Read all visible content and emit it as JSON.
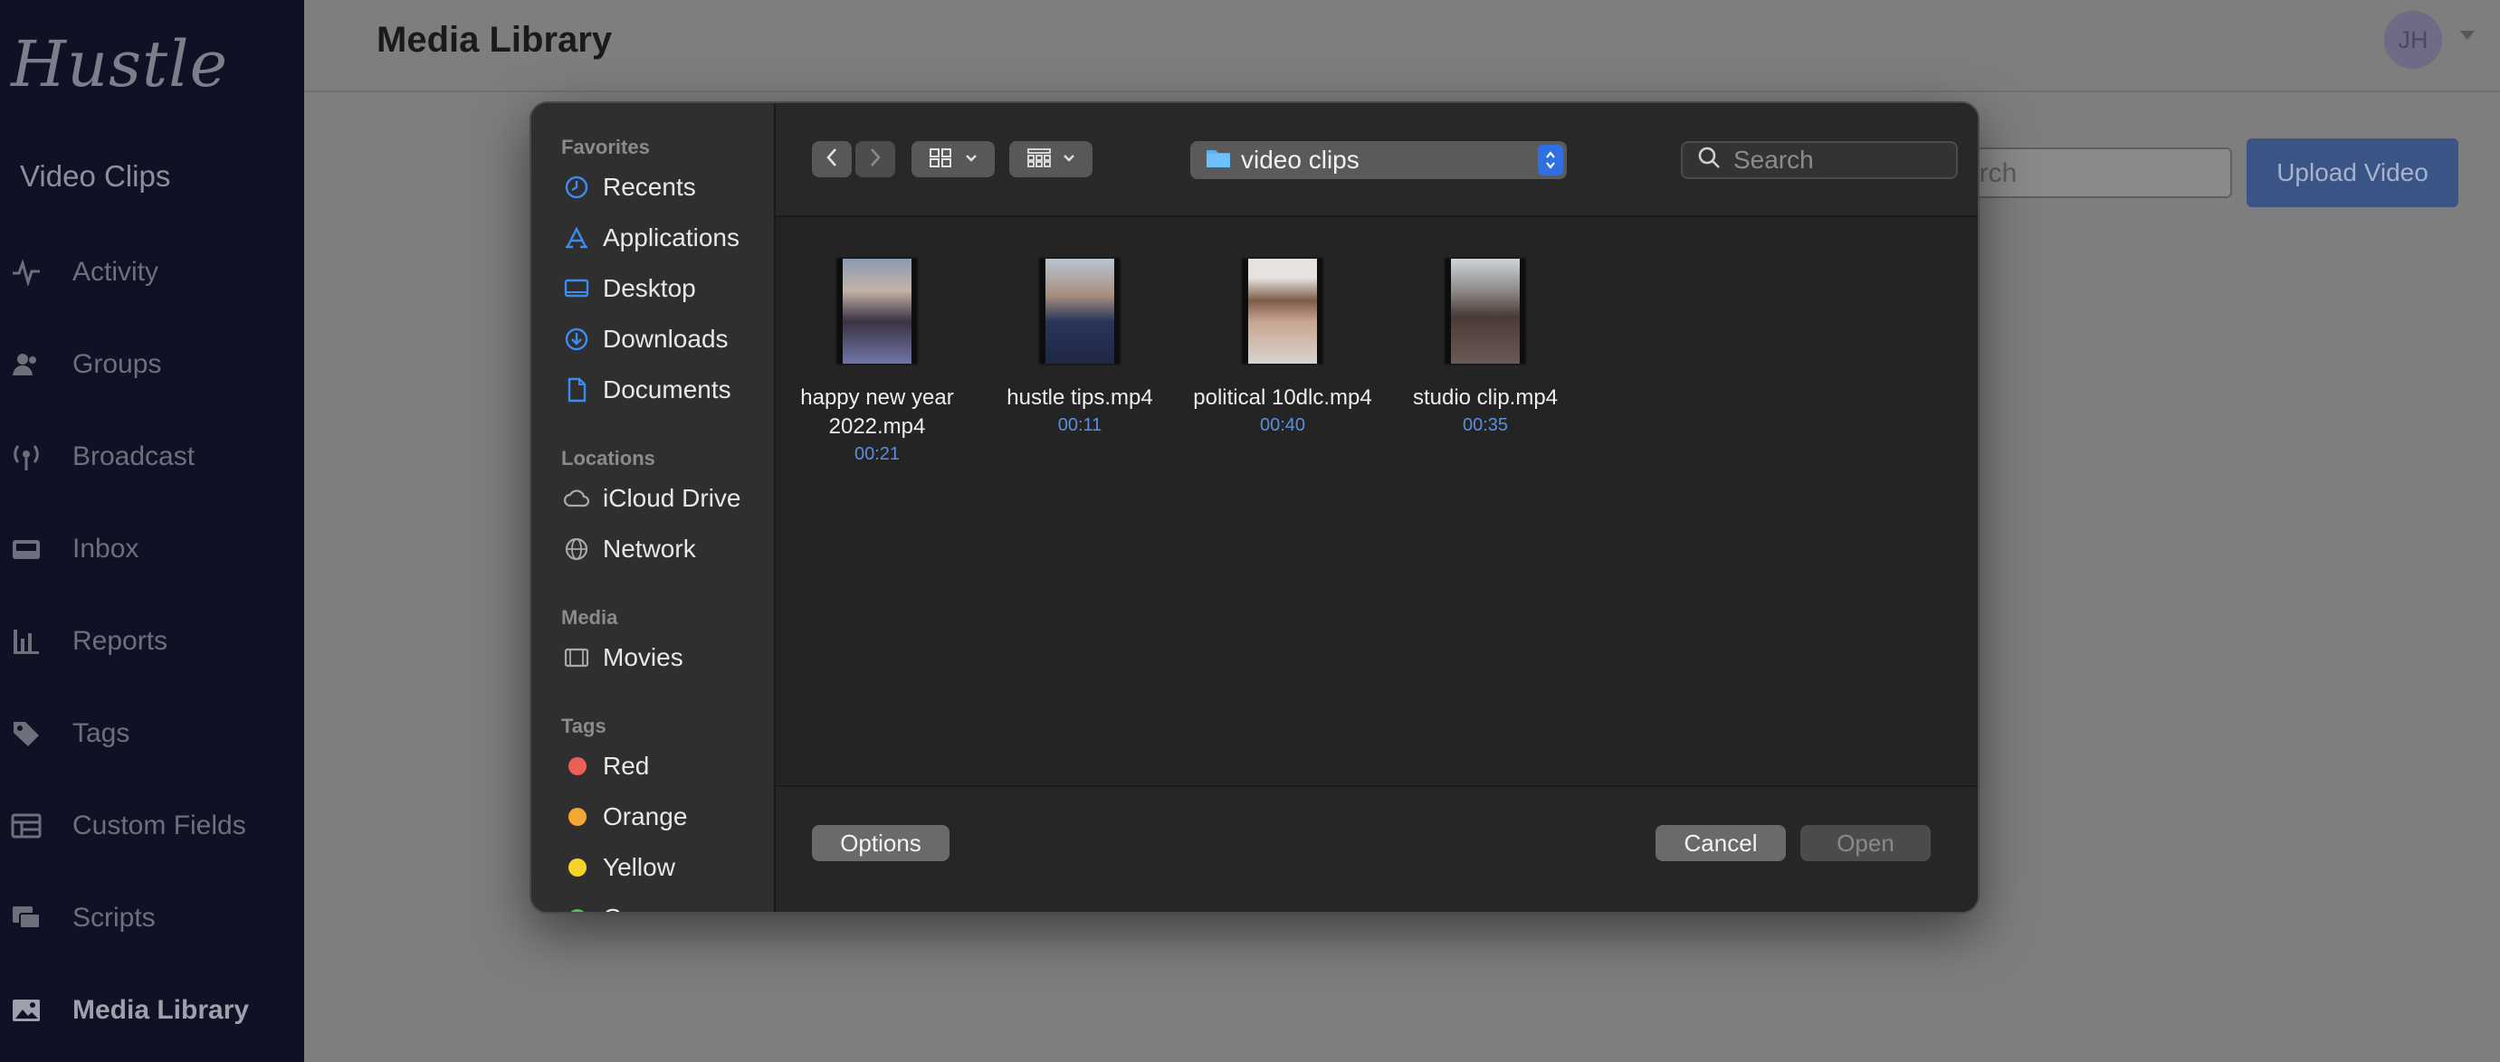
{
  "app": {
    "brand": "Hustle",
    "section_title": "Video Clips",
    "nav": [
      {
        "label": "Activity",
        "icon": "activity-icon"
      },
      {
        "label": "Groups",
        "icon": "groups-icon"
      },
      {
        "label": "Broadcast",
        "icon": "broadcast-icon"
      },
      {
        "label": "Inbox",
        "icon": "inbox-icon"
      },
      {
        "label": "Reports",
        "icon": "reports-icon"
      },
      {
        "label": "Tags",
        "icon": "tag-icon"
      },
      {
        "label": "Custom Fields",
        "icon": "custom-fields-icon"
      },
      {
        "label": "Scripts",
        "icon": "scripts-icon"
      },
      {
        "label": "Media Library",
        "icon": "media-icon",
        "active": true
      }
    ]
  },
  "header": {
    "title": "Media Library",
    "avatar_initials": "JH"
  },
  "page": {
    "search_placeholder_visible": "arch",
    "upload_button": "Upload Video",
    "accent_color": "#3a5486"
  },
  "dialog": {
    "sidebar": {
      "favorites_label": "Favorites",
      "favorites": [
        {
          "label": "Recents",
          "icon": "clock-icon"
        },
        {
          "label": "Applications",
          "icon": "applications-icon"
        },
        {
          "label": "Desktop",
          "icon": "desktop-icon"
        },
        {
          "label": "Downloads",
          "icon": "download-icon"
        },
        {
          "label": "Documents",
          "icon": "document-icon"
        }
      ],
      "locations_label": "Locations",
      "locations": [
        {
          "label": "iCloud Drive",
          "icon": "cloud-icon"
        },
        {
          "label": "Network",
          "icon": "globe-icon"
        }
      ],
      "media_label": "Media",
      "media": [
        {
          "label": "Movies",
          "icon": "film-icon"
        }
      ],
      "tags_label": "Tags",
      "tags": [
        {
          "label": "Red",
          "color": "#ec5f58"
        },
        {
          "label": "Orange",
          "color": "#f4a732"
        },
        {
          "label": "Yellow",
          "color": "#f6d32b"
        },
        {
          "label": "Green",
          "color": "#4dc25a"
        }
      ]
    },
    "toolbar": {
      "folder": "video clips",
      "search_placeholder": "Search"
    },
    "files": [
      {
        "name": "happy new year 2022.mp4",
        "duration": "00:21"
      },
      {
        "name": "hustle tips.mp4",
        "duration": "00:11"
      },
      {
        "name": "political 10dlc.mp4",
        "duration": "00:40"
      },
      {
        "name": "studio clip.mp4",
        "duration": "00:35"
      }
    ],
    "footer": {
      "options": "Options",
      "cancel": "Cancel",
      "open": "Open"
    }
  }
}
